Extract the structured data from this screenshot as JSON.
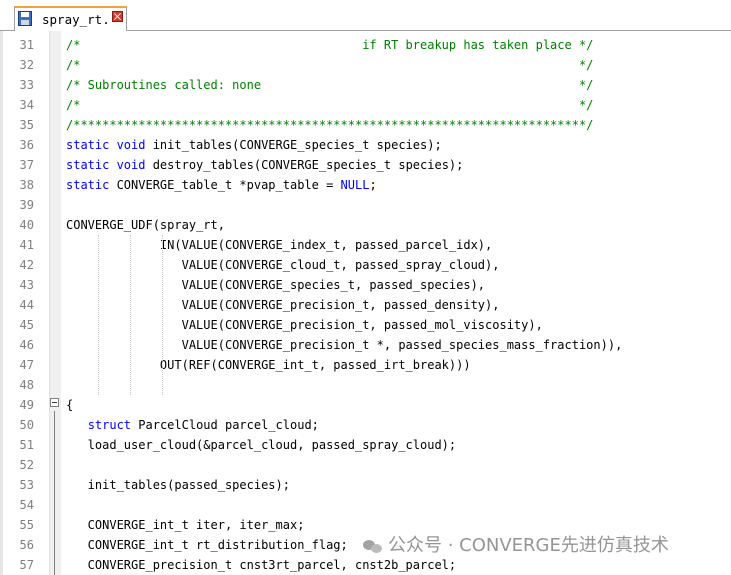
{
  "tab": {
    "title": "spray_rt."
  },
  "colors": {
    "comment": "#008000",
    "keyword": "#0000ff",
    "text": "#000000",
    "line_number": "#808080",
    "tab_accent": "#f2a23a"
  },
  "lines": [
    {
      "n": "31",
      "segs": [
        {
          "t": "/*                                       if RT breakup has taken place */",
          "c": "cm"
        }
      ]
    },
    {
      "n": "32",
      "segs": [
        {
          "t": "/*                                                                     */",
          "c": "cm"
        }
      ]
    },
    {
      "n": "33",
      "segs": [
        {
          "t": "/* Subroutines called: none                                            */",
          "c": "cm"
        }
      ]
    },
    {
      "n": "34",
      "segs": [
        {
          "t": "/*                                                                     */",
          "c": "cm"
        }
      ]
    },
    {
      "n": "35",
      "segs": [
        {
          "t": "/***********************************************************************/",
          "c": "cm"
        }
      ]
    },
    {
      "n": "36",
      "segs": [
        {
          "t": "static void",
          "c": "kw"
        },
        {
          "t": " init_tables(CONVERGE_species_t species);",
          "c": ""
        }
      ]
    },
    {
      "n": "37",
      "segs": [
        {
          "t": "static void",
          "c": "kw"
        },
        {
          "t": " destroy_tables(CONVERGE_species_t species);",
          "c": ""
        }
      ]
    },
    {
      "n": "38",
      "segs": [
        {
          "t": "static",
          "c": "kw"
        },
        {
          "t": " CONVERGE_table_t *pvap_table = ",
          "c": ""
        },
        {
          "t": "NULL",
          "c": "kw"
        },
        {
          "t": ";",
          "c": ""
        }
      ]
    },
    {
      "n": "39",
      "segs": []
    },
    {
      "n": "40",
      "segs": [
        {
          "t": "CONVERGE_UDF(spray_rt,",
          "c": ""
        }
      ]
    },
    {
      "n": "41",
      "segs": [
        {
          "t": "             IN(VALUE(CONVERGE_index_t, passed_parcel_idx),",
          "c": ""
        }
      ]
    },
    {
      "n": "42",
      "segs": [
        {
          "t": "                VALUE(CONVERGE_cloud_t, passed_spray_cloud),",
          "c": ""
        }
      ]
    },
    {
      "n": "43",
      "segs": [
        {
          "t": "                VALUE(CONVERGE_species_t, passed_species),",
          "c": ""
        }
      ]
    },
    {
      "n": "44",
      "segs": [
        {
          "t": "                VALUE(CONVERGE_precision_t, passed_density),",
          "c": ""
        }
      ]
    },
    {
      "n": "45",
      "segs": [
        {
          "t": "                VALUE(CONVERGE_precision_t, passed_mol_viscosity),",
          "c": ""
        }
      ]
    },
    {
      "n": "46",
      "segs": [
        {
          "t": "                VALUE(CONVERGE_precision_t *, passed_species_mass_fraction)),",
          "c": ""
        }
      ]
    },
    {
      "n": "47",
      "segs": [
        {
          "t": "             OUT(REF(CONVERGE_int_t, passed_irt_break)))",
          "c": ""
        }
      ]
    },
    {
      "n": "48",
      "segs": []
    },
    {
      "n": "49",
      "segs": [
        {
          "t": "{",
          "c": ""
        }
      ]
    },
    {
      "n": "50",
      "segs": [
        {
          "t": "   ",
          "c": ""
        },
        {
          "t": "struct",
          "c": "kw"
        },
        {
          "t": " ParcelCloud parcel_cloud;",
          "c": ""
        }
      ]
    },
    {
      "n": "51",
      "segs": [
        {
          "t": "   load_user_cloud(&parcel_cloud, passed_spray_cloud);",
          "c": ""
        }
      ]
    },
    {
      "n": "52",
      "segs": []
    },
    {
      "n": "53",
      "segs": [
        {
          "t": "   init_tables(passed_species);",
          "c": ""
        }
      ]
    },
    {
      "n": "54",
      "segs": []
    },
    {
      "n": "55",
      "segs": [
        {
          "t": "   CONVERGE_int_t iter, iter_max;",
          "c": ""
        }
      ]
    },
    {
      "n": "56",
      "segs": [
        {
          "t": "   CONVERGE_int_t rt_distribution_flag;",
          "c": ""
        }
      ]
    },
    {
      "n": "57",
      "segs": [
        {
          "t": "   CONVERGE_precision_t cnst3rt_parcel, cnst2b_parcel;",
          "c": ""
        }
      ]
    }
  ],
  "watermark": {
    "text": "公众号 · CONVERGE先进仿真技术"
  }
}
